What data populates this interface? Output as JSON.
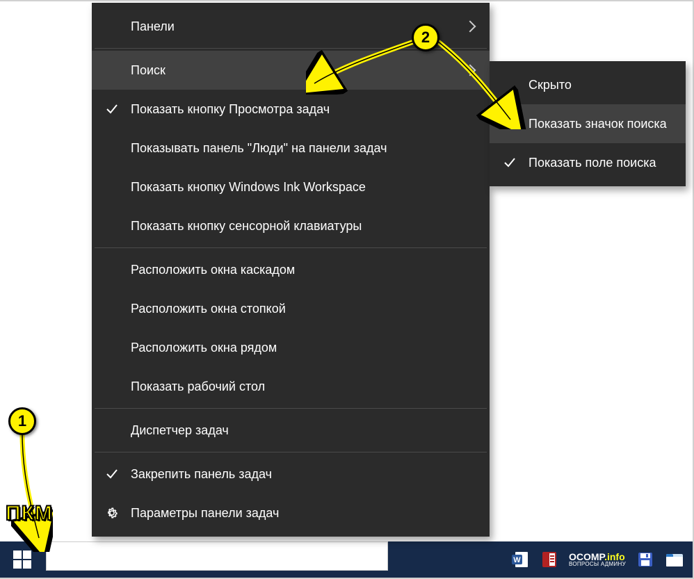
{
  "annotations": {
    "badge1": "1",
    "badge2": "2",
    "pkm_label": "ПКМ"
  },
  "main_menu": {
    "panels": "Панели",
    "search": "Поиск",
    "taskview": "Показать кнопку Просмотра задач",
    "people": "Показывать панель \"Люди\" на панели задач",
    "ink": "Показать кнопку Windows Ink Workspace",
    "touchkb": "Показать кнопку сенсорной клавиатуры",
    "cascade": "Расположить окна каскадом",
    "stacked": "Расположить окна стопкой",
    "sidebyside": "Расположить окна рядом",
    "desktop": "Показать рабочий стол",
    "taskmgr": "Диспетчер задач",
    "lock": "Закрепить панель задач",
    "settings": "Параметры панели задач"
  },
  "sub_menu": {
    "hidden": "Скрыто",
    "show_icon": "Показать значок поиска",
    "show_box": "Показать поле поиска"
  },
  "watermark": {
    "brand": "OCOMP",
    "suffix": ".info",
    "tagline": "ВОПРОСЫ АДМИНУ"
  }
}
